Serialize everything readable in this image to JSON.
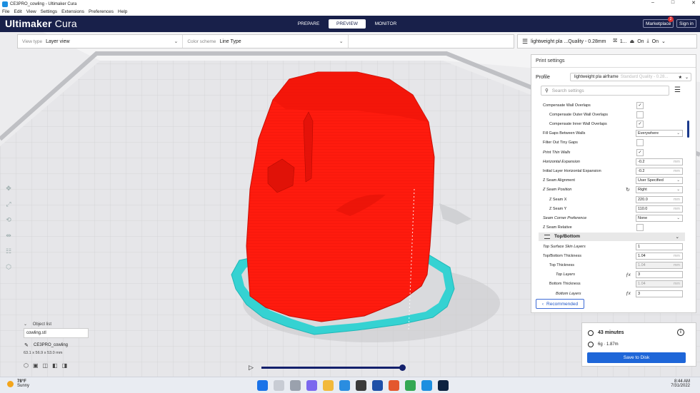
{
  "window": {
    "title": "CE3PRO_cowling - Ultimaker Cura",
    "controls": [
      "–",
      "□",
      "✕"
    ]
  },
  "menu": [
    "File",
    "Edit",
    "View",
    "Settings",
    "Extensions",
    "Preferences",
    "Help"
  ],
  "header": {
    "brand_strong": "Ultimaker",
    "brand_light": " Cura",
    "stages": [
      "PREPARE",
      "PREVIEW",
      "MONITOR"
    ],
    "active_stage": "PREVIEW",
    "marketplace": "Marketplace",
    "marketplace_badge": "2",
    "sign_in": "Sign in"
  },
  "view": {
    "view_type_label": "View type",
    "view_type_value": "Layer view",
    "color_scheme_label": "Color scheme",
    "color_scheme_value": "Line Type"
  },
  "quick_settings": {
    "profile": "lightweight pla ...Quality - 0.28mm",
    "support_value": "1...",
    "adhesion_state": "On",
    "infill_state": "On"
  },
  "print_settings": {
    "title": "Print settings",
    "profile_label": "Profile",
    "profile_name": "lightweight pla airframe",
    "profile_quality": "Standard Quality - 0.28...",
    "search_placeholder": "Search settings",
    "rows": [
      {
        "name": "Compensate Wall Overlaps",
        "indent": 0,
        "control": "check",
        "value": "✓"
      },
      {
        "name": "Compensate Outer Wall Overlaps",
        "indent": 1,
        "control": "check",
        "value": ""
      },
      {
        "name": "Compensate Inner Wall Overlaps",
        "indent": 1,
        "control": "check",
        "value": "✓"
      },
      {
        "name": "Fill Gaps Between Walls",
        "indent": 0,
        "control": "select",
        "value": "Everywhere"
      },
      {
        "name": "Filter Out Tiny Gaps",
        "indent": 0,
        "control": "check",
        "value": ""
      },
      {
        "name": "Print Thin Walls",
        "indent": 0,
        "italic": true,
        "control": "check",
        "value": "✓"
      },
      {
        "name": "Horizontal Expansion",
        "indent": 0,
        "italic": true,
        "control": "input",
        "value": "-0.2",
        "unit": "mm"
      },
      {
        "name": "Initial Layer Horizontal Expansion",
        "indent": 0,
        "control": "input",
        "value": "-0.2",
        "unit": "mm"
      },
      {
        "name": "Z Seam Alignment",
        "indent": 0,
        "control": "select",
        "value": "User Specified"
      },
      {
        "name": "Z Seam Position",
        "indent": 0,
        "italic": true,
        "control": "select",
        "value": "Right",
        "reset": true
      },
      {
        "name": "Z Seam X",
        "indent": 1,
        "control": "input",
        "value": "220.0",
        "unit": "mm"
      },
      {
        "name": "Z Seam Y",
        "indent": 1,
        "control": "input",
        "value": "110.0",
        "unit": "mm"
      },
      {
        "name": "Seam Corner Preference",
        "indent": 0,
        "italic": true,
        "control": "select",
        "value": "None"
      },
      {
        "name": "Z Seam Relative",
        "indent": 0,
        "control": "check",
        "value": ""
      },
      {
        "category": "Top/Bottom"
      },
      {
        "name": "Top Surface Skin Layers",
        "indent": 0,
        "italic": true,
        "control": "input",
        "value": "1",
        "unit": ""
      },
      {
        "name": "Top/Bottom Thickness",
        "indent": 0,
        "control": "input",
        "value": "1.04",
        "unit": "mm"
      },
      {
        "name": "Top Thickness",
        "indent": 1,
        "control": "input",
        "value": "1.04",
        "unit": "mm",
        "disabled": true
      },
      {
        "name": "Top Layers",
        "indent": 2,
        "italic": true,
        "control": "input",
        "value": "3",
        "unit": "",
        "fx": true
      },
      {
        "name": "Bottom Thickness",
        "indent": 1,
        "control": "input",
        "value": "1.04",
        "unit": "mm",
        "disabled": true
      },
      {
        "name": "Bottom Layers",
        "indent": 2,
        "italic": true,
        "control": "input",
        "value": "3",
        "unit": "",
        "fx": true
      }
    ],
    "recommended_label": "Recommended"
  },
  "estimate": {
    "time": "43 minutes",
    "material": "6g · 1.87m",
    "save_label": "Save to Disk"
  },
  "object_list": {
    "heading": "Object list",
    "file": "cowling.stl",
    "object_name": "CE3PRO_cowling",
    "dimensions": "63.1 x 56.9 x 53.0 mm"
  },
  "taskbar": {
    "temperature": "78°F",
    "condition": "Sunny",
    "time": "8:44 AM",
    "date": "7/31/2022"
  },
  "colors": {
    "header": "#18204a",
    "model": "#ff1b0e",
    "skirt": "#35d2d2",
    "accent": "#1e66d8"
  }
}
